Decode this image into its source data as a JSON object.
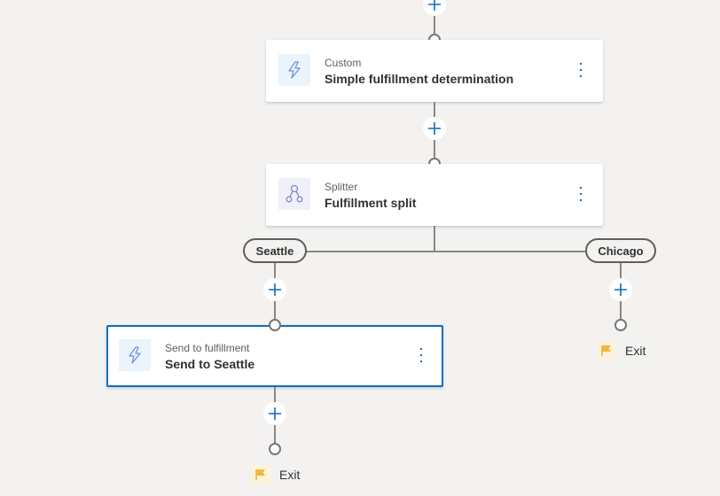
{
  "flow": {
    "steps": [
      {
        "type_label": "Custom",
        "title": "Simple fulfillment determination",
        "icon": "lightning-icon"
      },
      {
        "type_label": "Splitter",
        "title": "Fulfillment split",
        "icon": "splitter-icon"
      }
    ],
    "branches": [
      {
        "label": "Seattle",
        "steps": [
          {
            "type_label": "Send to fulfillment",
            "title": "Send to Seattle",
            "icon": "lightning-icon",
            "selected": true
          }
        ],
        "exit_label": "Exit"
      },
      {
        "label": "Chicago",
        "steps": [],
        "exit_label": "Exit"
      }
    ],
    "colors": {
      "accent": "#0f6cbd",
      "connector": "#8a8886",
      "canvas": "#f3f2f1",
      "exit_flag": "#f2b63c"
    }
  }
}
